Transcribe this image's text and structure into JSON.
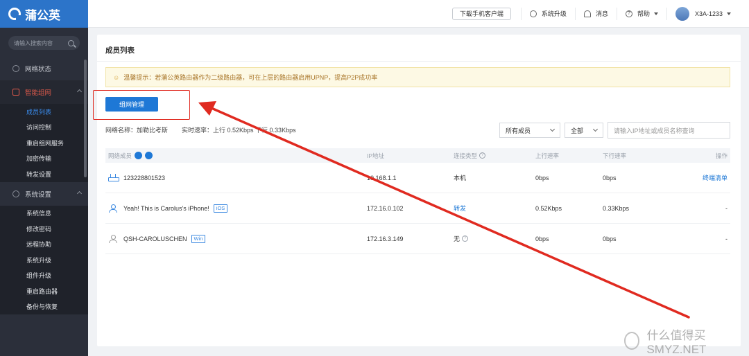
{
  "app": {
    "name": "蒲公英"
  },
  "sidebar": {
    "search_placeholder": "请输入搜索内容",
    "groups": [
      {
        "label": "网络状态"
      },
      {
        "label": "智能组网"
      },
      {
        "label": "系统设置"
      }
    ],
    "network_items": [
      {
        "label": "成员列表"
      },
      {
        "label": "访问控制"
      },
      {
        "label": "重启组网服务"
      },
      {
        "label": "加密传输"
      },
      {
        "label": "转发设置"
      }
    ],
    "system_items": [
      {
        "label": "系统信息"
      },
      {
        "label": "修改密码"
      },
      {
        "label": "远程协助"
      },
      {
        "label": "系统升级"
      },
      {
        "label": "组件升级"
      },
      {
        "label": "重启路由器"
      },
      {
        "label": "备份与恢复"
      }
    ]
  },
  "header": {
    "download_label": "下载手机客户端",
    "upgrade_label": "系统升级",
    "messages_label": "消息",
    "help_label": "帮助",
    "device_name": "X3A-1233"
  },
  "main": {
    "title": "成员列表",
    "tip": "温馨提示：若蒲公英路由器作为二级路由器，可在上层的路由器启用UPNP，提高P2P成功率",
    "manage_button": "组网管理",
    "network_name": "网络名称：加勒比考斯",
    "speed": "实时速率：上行 0.52Kbps   下行 0.33Kbps",
    "filter_member": "所有成员",
    "filter_all": "全部",
    "search_placeholder": "请输入IP地址或成员名称查询",
    "columns": {
      "member": "网络成员",
      "ip": "IP地址",
      "conn": "连接类型",
      "up": "上行速率",
      "down": "下行速率",
      "action": "操作"
    },
    "rows": [
      {
        "name": "123228801523",
        "tag": "",
        "ip": "10.168.1.1",
        "conn": "本机",
        "up": "0bps",
        "down": "0bps",
        "action": "终端清单"
      },
      {
        "name": "Yeah! This is Carolus's iPhone!",
        "tag": "iOS",
        "ip": "172.16.0.102",
        "conn": "转发",
        "up": "0.52Kbps",
        "down": "0.33Kbps",
        "action": "-"
      },
      {
        "name": "QSH-CAROLUSCHEN",
        "tag": "Win",
        "ip": "172.16.3.149",
        "conn": "无",
        "up": "0bps",
        "down": "0bps",
        "action": "-"
      }
    ]
  },
  "watermark": {
    "text": "什么值得买 SMYZ.NET"
  },
  "colors": {
    "brand": "#2c74c9",
    "primary": "#1e78d6",
    "annotation": "#e02a20",
    "sidebar_bg": "#2b2f3a"
  }
}
